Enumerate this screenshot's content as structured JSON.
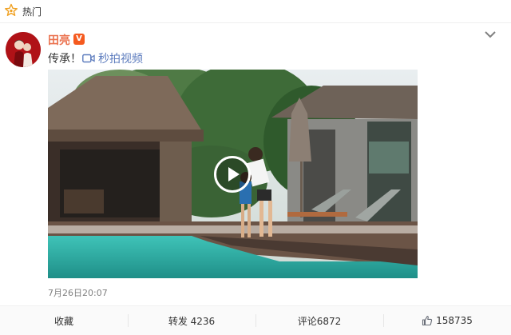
{
  "header": {
    "hot_label": "热门"
  },
  "post": {
    "username": "田亮",
    "verified_badge": "V",
    "text": "传承！",
    "video_link_label": "秒拍视频",
    "timestamp": "7月26日20:07"
  },
  "actions": {
    "favorite": "收藏",
    "repost": "转发 4236",
    "comment": "评论6872",
    "like_count": "158735"
  },
  "icons": {
    "hot": "hot-star-icon",
    "more": "chevron-down-icon",
    "video": "video-camera-icon",
    "play": "play-icon",
    "like": "thumbs-up-icon"
  },
  "colors": {
    "accent": "#eb7350",
    "link": "#5d7cbe",
    "badge": "#f55a1f"
  }
}
